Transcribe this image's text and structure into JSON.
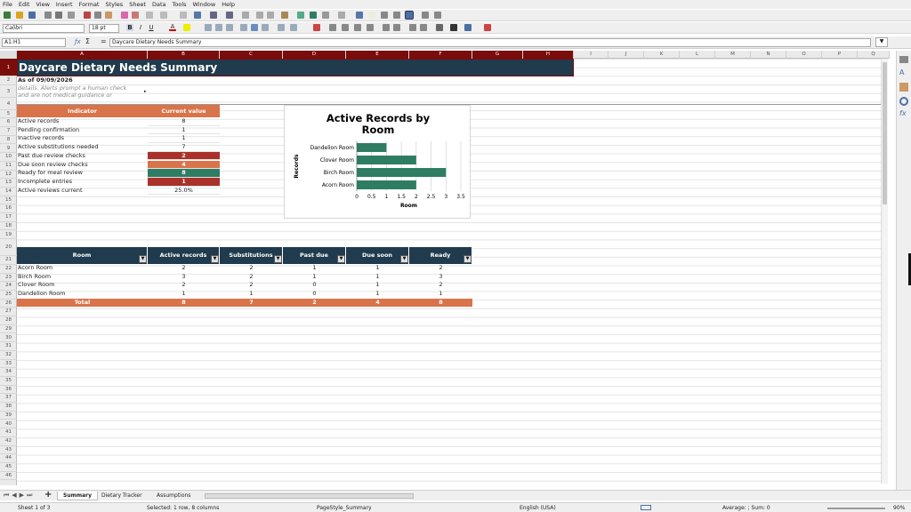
{
  "menu": [
    "File",
    "Edit",
    "View",
    "Insert",
    "Format",
    "Styles",
    "Sheet",
    "Data",
    "Tools",
    "Window",
    "Help"
  ],
  "toolbar": {
    "font_name": "Calibri",
    "font_size": "18 pt"
  },
  "formula": {
    "name_box": "A1:H1",
    "content": "Daycare Dietary Needs Summary"
  },
  "columns": [
    "A",
    "B",
    "C",
    "D",
    "E",
    "F",
    "G",
    "H",
    "I",
    "J",
    "K",
    "L",
    "M",
    "N",
    "O",
    "P",
    "Q"
  ],
  "rows": [
    "1",
    "2",
    "3",
    "4",
    "5",
    "6",
    "7",
    "8",
    "9",
    "10",
    "11",
    "12",
    "13",
    "14",
    "15",
    "16",
    "17",
    "18",
    "19",
    "20",
    "21",
    "22",
    "23",
    "24",
    "25",
    "26",
    "27",
    "28",
    "29",
    "30",
    "31",
    "32",
    "33",
    "34",
    "35",
    "36",
    "37",
    "38",
    "39",
    "40",
    "41",
    "42",
    "43",
    "44",
    "45",
    "46"
  ],
  "sheet": {
    "title": "Daycare Dietary Needs Summary",
    "as_of": "As of 09/09/2026",
    "note_lines": [
      "details. Alerts prompt a human check",
      "and are not medical guidance or"
    ],
    "ind_headers": [
      "Indicator",
      "Current value"
    ],
    "indicators": [
      {
        "label": "Active records",
        "value": "8"
      },
      {
        "label": "Pending confirmation",
        "value": "1"
      },
      {
        "label": "Inactive records",
        "value": "1"
      },
      {
        "label": "Active substitutions needed",
        "value": "7"
      },
      {
        "label": "Past due review checks",
        "value": "2",
        "color": "#a9312a"
      },
      {
        "label": "Due soon review checks",
        "value": "4",
        "color": "#d9734a"
      },
      {
        "label": "Ready for meal review",
        "value": "8",
        "color": "#2e7d62"
      },
      {
        "label": "Incomplete entries",
        "value": "1",
        "color": "#a9312a"
      },
      {
        "label": "Active reviews current",
        "value": "25.0%"
      }
    ],
    "room_headers": [
      "Room",
      "Active records",
      "Substitutions",
      "Past due",
      "Due soon",
      "Ready"
    ],
    "rooms": [
      [
        "Acorn Room",
        "2",
        "2",
        "1",
        "1",
        "2"
      ],
      [
        "Birch Room",
        "3",
        "2",
        "1",
        "1",
        "3"
      ],
      [
        "Clover Room",
        "2",
        "2",
        "0",
        "1",
        "2"
      ],
      [
        "Dandelion Room",
        "1",
        "1",
        "0",
        "1",
        "1"
      ]
    ],
    "total": [
      "Total",
      "8",
      "7",
      "2",
      "4",
      "8"
    ]
  },
  "colors": {
    "header_dark": "#1f3b4d",
    "accent_orange": "#d9734a",
    "bar_green": "#2e7d62",
    "selection": "#7a0c0c"
  },
  "chart_data": {
    "type": "bar",
    "orientation": "horizontal",
    "title": "Active Records by Room",
    "categories": [
      "Dandelion Room",
      "Clover Room",
      "Birch Room",
      "Acorn Room"
    ],
    "values": [
      1,
      2,
      3,
      2
    ],
    "xlabel": "Room",
    "ylabel": "Records",
    "xlim": [
      0,
      3.5
    ],
    "ticks": [
      "0",
      "0.5",
      "1",
      "1.5",
      "2",
      "2.5",
      "3",
      "3.5"
    ],
    "grid": true
  },
  "tabs": [
    "Summary",
    "Dietary Tracker",
    "Assumptions"
  ],
  "status": {
    "sheet": "Sheet 1 of 3",
    "selected": "Selected: 1 row, 8 columns",
    "page_style": "PageStyle_Summary",
    "language": "English (USA)",
    "sum": "Average: ; Sum: 0",
    "zoom": "90%"
  }
}
